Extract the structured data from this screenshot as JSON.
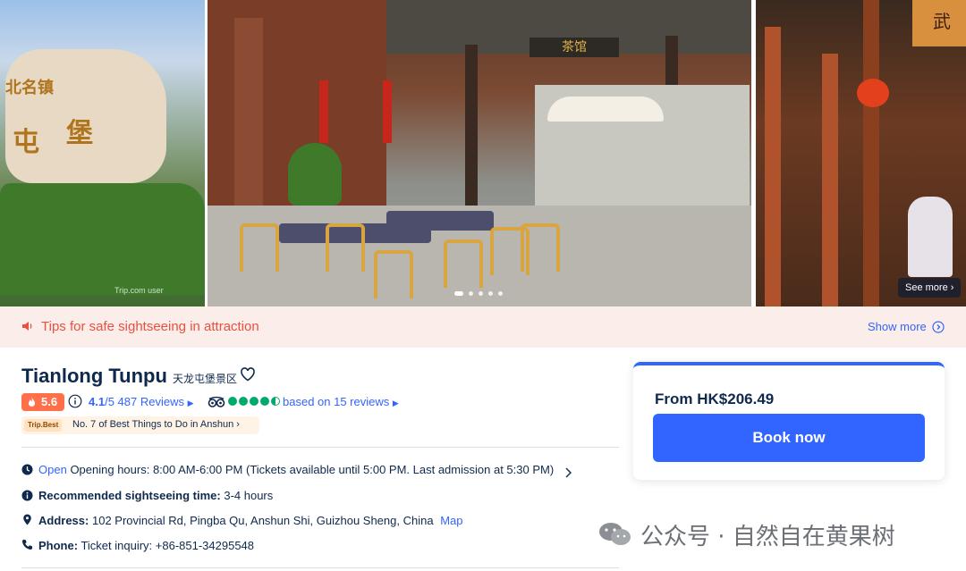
{
  "gallery": {
    "left_photo": {
      "rock_chars": [
        "北名镇",
        "屯",
        "堡"
      ],
      "credit": "Trip.com user"
    },
    "main_photo": {
      "sign": "茶馆",
      "carousel": {
        "count": 5,
        "active": 0
      }
    },
    "right_photo": {
      "sign": "武"
    },
    "see_more_label": "See more"
  },
  "tips": {
    "text": "Tips for safe sightseeing in attraction",
    "show_more_label": "Show more",
    "icon": "speaker-icon"
  },
  "attraction": {
    "name": "Tianlong Tunpu",
    "name_cn": "天龙屯堡景区",
    "score": "5.6",
    "rating": "4.1",
    "rating_scale": "/5",
    "reviews_label": "487 Reviews",
    "tripadvisor_rating": 4.5,
    "tripadvisor_text": "based on 15 reviews",
    "rank_tag": "Trip.Best",
    "rank_text": "No. 7 of Best Things to Do in Anshun"
  },
  "details": {
    "open_status": "Open",
    "hours": "Opening hours: 8:00 AM-6:00 PM (Tickets available until 5:00 PM. Last admission at 5:30 PM)",
    "recommended_label": "Recommended sightseeing time:",
    "recommended_value": "3-4 hours",
    "address_label": "Address:",
    "address_value": "102 Provincial Rd, Pingba Qu, Anshun Shi, Guizhou Sheng, China",
    "map_label": "Map",
    "phone_label": "Phone:",
    "phone_value": "Ticket inquiry: +86-851-34295548"
  },
  "booking": {
    "price_prefix": "From",
    "price": "HK$206.49",
    "book_label": "Book now"
  },
  "watermark": {
    "text": "公众号 · 自然自在黄果树"
  },
  "colors": {
    "accent": "#3264ff",
    "score": "#ff6f4a",
    "tripadvisor": "#00aa6c",
    "tips": "#e9503f"
  }
}
